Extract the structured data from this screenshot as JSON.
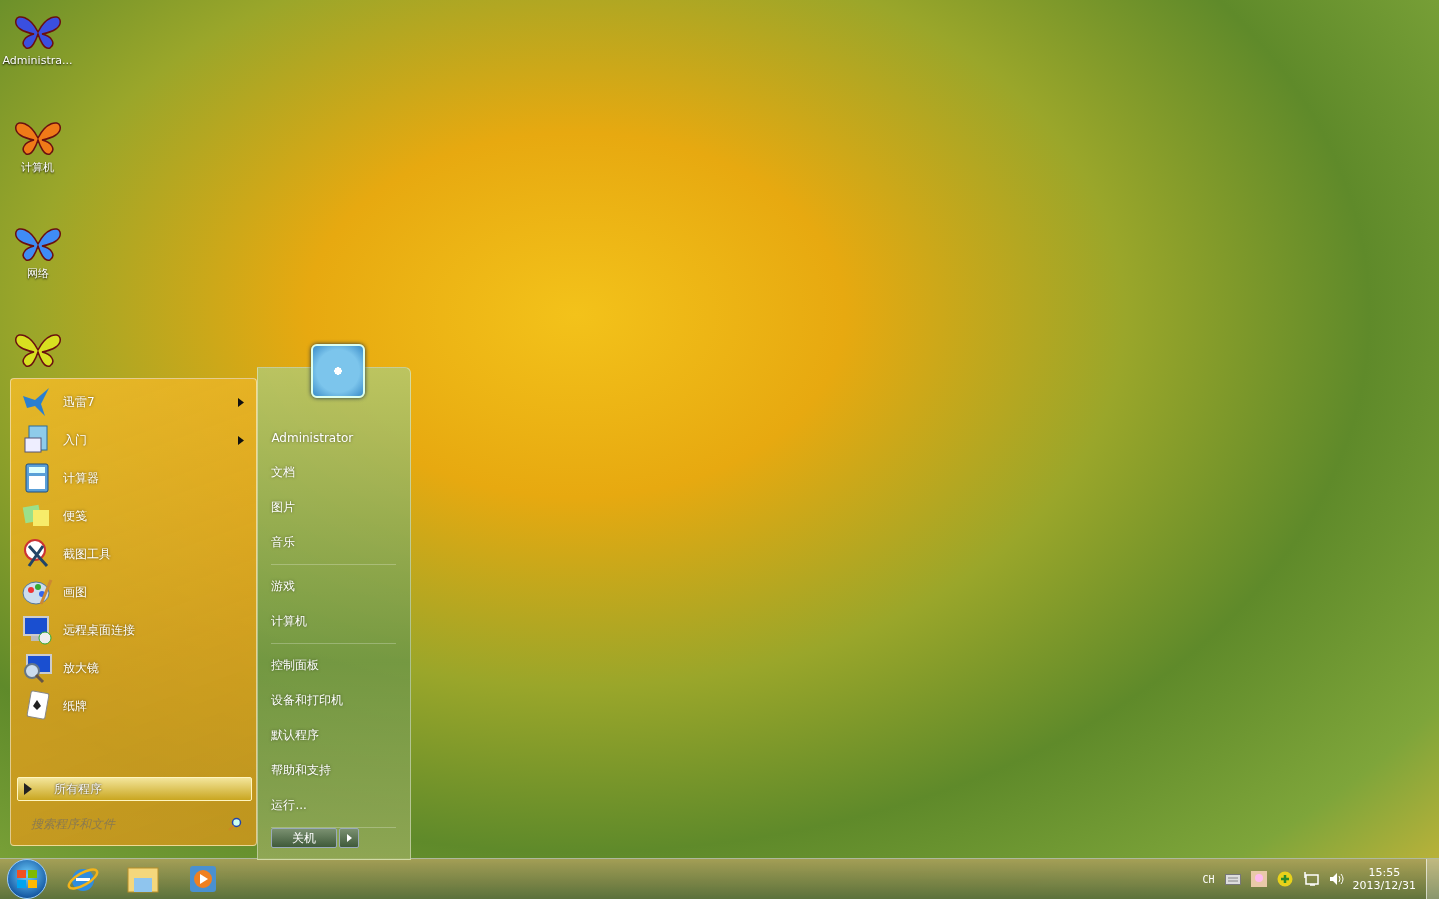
{
  "desktop_icons": [
    {
      "label": "Administra...",
      "color": "#3a4fe0"
    },
    {
      "label": "计算机",
      "color": "#f07a18"
    },
    {
      "label": "网络",
      "color": "#3f8cf5"
    },
    {
      "color": "#d8e020"
    }
  ],
  "start_menu": {
    "programs": [
      {
        "label": "迅雷7",
        "has_submenu": true,
        "kind": "bird"
      },
      {
        "label": "入门",
        "has_submenu": true,
        "kind": "doc"
      },
      {
        "label": "计算器",
        "has_submenu": false,
        "kind": "calc"
      },
      {
        "label": "便笺",
        "has_submenu": false,
        "kind": "notes"
      },
      {
        "label": "截图工具",
        "has_submenu": false,
        "kind": "scissors"
      },
      {
        "label": "画图",
        "has_submenu": false,
        "kind": "palette"
      },
      {
        "label": "远程桌面连接",
        "has_submenu": false,
        "kind": "monitor"
      },
      {
        "label": "放大镜",
        "has_submenu": false,
        "kind": "magnifier"
      },
      {
        "label": "纸牌",
        "has_submenu": false,
        "kind": "cards"
      }
    ],
    "all_programs": "所有程序",
    "search": {
      "placeholder": "搜索程序和文件"
    },
    "links": [
      [
        "Administrator",
        "文档",
        "图片",
        "音乐"
      ],
      [
        "游戏",
        "计算机"
      ],
      [
        "控制面板",
        "设备和打印机",
        "默认程序",
        "帮助和支持",
        "运行..."
      ]
    ],
    "shutdown": "关机"
  },
  "taskbar": {
    "pinned": [
      {
        "kind": "browser"
      },
      {
        "kind": "folder"
      },
      {
        "kind": "media"
      }
    ],
    "language": "CH",
    "clock": {
      "time": "15:55",
      "date": "2013/12/31"
    }
  }
}
